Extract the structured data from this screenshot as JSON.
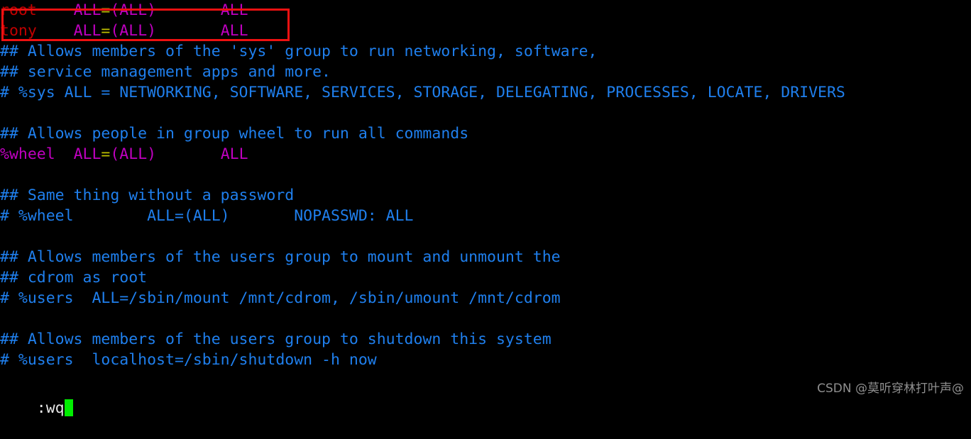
{
  "terminal": {
    "app": "vi-sudoers-editor",
    "background": "#000000",
    "colors": {
      "comment": "#1f7fed",
      "user": "#c00000",
      "group": "#c000c0",
      "equals": "#c0c000",
      "plain": "#d8d8d8",
      "cursor": "#00ee00",
      "highlight_box": "#ee1111",
      "watermark": "#8f8f8f"
    },
    "lines": [
      {
        "id": "line-root-rule",
        "indent": 0,
        "segments": [
          {
            "text": "root",
            "style": "c-user"
          },
          {
            "text": "    ",
            "style": "c-plain"
          },
          {
            "text": "ALL",
            "style": "c-group"
          },
          {
            "text": "=",
            "style": "c-eq"
          },
          {
            "text": "(ALL)",
            "style": "c-group"
          },
          {
            "text": "       ",
            "style": "c-plain"
          },
          {
            "text": "ALL",
            "style": "c-group"
          }
        ],
        "plain": "root    ALL=(ALL)       ALL"
      },
      {
        "id": "line-tony-rule",
        "indent": 0,
        "segments": [
          {
            "text": "tony",
            "style": "c-user"
          },
          {
            "text": "    ",
            "style": "c-plain"
          },
          {
            "text": "ALL",
            "style": "c-group"
          },
          {
            "text": "=",
            "style": "c-eq"
          },
          {
            "text": "(ALL)",
            "style": "c-group"
          },
          {
            "text": "       ",
            "style": "c-plain"
          },
          {
            "text": "ALL",
            "style": "c-group"
          }
        ],
        "plain": "tony    ALL=(ALL)       ALL"
      },
      {
        "id": "line-comment-sys-1",
        "segments": [
          {
            "text": "## Allows members of the 'sys' group to run networking, software,",
            "style": "c-comment"
          }
        ],
        "plain": "## Allows members of the 'sys' group to run networking, software,"
      },
      {
        "id": "line-comment-sys-2",
        "segments": [
          {
            "text": "## service management apps and more.",
            "style": "c-comment"
          }
        ],
        "plain": "## service management apps and more."
      },
      {
        "id": "line-comment-sys-rule",
        "segments": [
          {
            "text": "# %sys ALL = NETWORKING, SOFTWARE, SERVICES, STORAGE, DELEGATING, PROCESSES, LOCATE, DRIVERS",
            "style": "c-comment"
          }
        ],
        "plain": "# %sys ALL = NETWORKING, SOFTWARE, SERVICES, STORAGE, DELEGATING, PROCESSES, LOCATE, DRIVERS"
      },
      {
        "id": "line-blank-1",
        "segments": [],
        "plain": ""
      },
      {
        "id": "line-comment-wheel",
        "segments": [
          {
            "text": "## Allows people in group wheel to run all commands",
            "style": "c-comment"
          }
        ],
        "plain": "## Allows people in group wheel to run all commands"
      },
      {
        "id": "line-wheel-rule",
        "segments": [
          {
            "text": "%wheel",
            "style": "c-spec"
          },
          {
            "text": "  ",
            "style": "c-plain"
          },
          {
            "text": "ALL",
            "style": "c-group"
          },
          {
            "text": "=",
            "style": "c-eq"
          },
          {
            "text": "(ALL)",
            "style": "c-group"
          },
          {
            "text": "       ",
            "style": "c-plain"
          },
          {
            "text": "ALL",
            "style": "c-group"
          }
        ],
        "plain": "%wheel  ALL=(ALL)       ALL"
      },
      {
        "id": "line-blank-2",
        "segments": [],
        "plain": ""
      },
      {
        "id": "line-comment-nopasswd",
        "segments": [
          {
            "text": "## Same thing without a password",
            "style": "c-comment"
          }
        ],
        "plain": "## Same thing without a password"
      },
      {
        "id": "line-wheel-nopasswd",
        "segments": [
          {
            "text": "# %wheel        ALL=(ALL)       NOPASSWD: ALL",
            "style": "c-comment"
          }
        ],
        "plain": "# %wheel        ALL=(ALL)       NOPASSWD: ALL"
      },
      {
        "id": "line-blank-3",
        "segments": [],
        "plain": ""
      },
      {
        "id": "line-comment-cdrom-1",
        "segments": [
          {
            "text": "## Allows members of the users group to mount and unmount the",
            "style": "c-comment"
          }
        ],
        "plain": "## Allows members of the users group to mount and unmount the"
      },
      {
        "id": "line-comment-cdrom-2",
        "segments": [
          {
            "text": "## cdrom as root",
            "style": "c-comment"
          }
        ],
        "plain": "## cdrom as root"
      },
      {
        "id": "line-users-cdrom-rule",
        "segments": [
          {
            "text": "# %users  ALL=/sbin/mount /mnt/cdrom, /sbin/umount /mnt/cdrom",
            "style": "c-comment"
          }
        ],
        "plain": "# %users  ALL=/sbin/mount /mnt/cdrom, /sbin/umount /mnt/cdrom"
      },
      {
        "id": "line-blank-4",
        "segments": [],
        "plain": ""
      },
      {
        "id": "line-comment-shutdown",
        "segments": [
          {
            "text": "## Allows members of the users group to shutdown this system",
            "style": "c-comment"
          }
        ],
        "plain": "## Allows members of the users group to shutdown this system"
      },
      {
        "id": "line-users-shutdown-rule",
        "segments": [
          {
            "text": "# %users  localhost=/sbin/shutdown -h now",
            "style": "c-comment"
          }
        ],
        "plain": "# %users  localhost=/sbin/shutdown -h now"
      }
    ],
    "status_line": {
      "command": ":wq",
      "cursor": "block"
    },
    "highlight": {
      "label": "annotation-rectangle",
      "covers": "root and tony sudoers rules"
    }
  },
  "watermark": {
    "text": "CSDN @莫听穿林打叶声@"
  }
}
